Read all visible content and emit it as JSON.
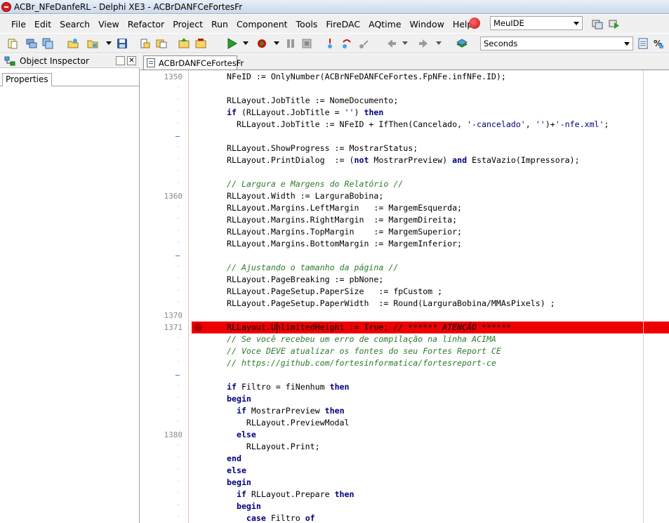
{
  "window": {
    "title": "ACBr_NFeDanfeRL - Delphi XE3 - ACBrDANFCeFortesFr",
    "app_icon": "delphi-icon"
  },
  "menu": {
    "items": [
      "File",
      "Edit",
      "Search",
      "View",
      "Refactor",
      "Project",
      "Run",
      "Component",
      "Tools",
      "FireDAC",
      "AQtime",
      "Window",
      "Help"
    ],
    "desktop_combo": "MeuIDE",
    "units_combo": "Seconds"
  },
  "object_inspector": {
    "title": "Object Inspector",
    "tab": "Properties"
  },
  "editor": {
    "tab_label": "ACBrDANFCeFortesFr",
    "line_numbers": [
      {
        "row": 0,
        "label": "1350"
      },
      {
        "row": 10,
        "label": "1360"
      },
      {
        "row": 20,
        "label": "1370"
      },
      {
        "row": 21,
        "label": "1371"
      },
      {
        "row": 30,
        "label": "1380"
      }
    ],
    "highlighted_row": 21,
    "lines": [
      "NFeID := OnlyNumber(ACBrNFeDANFCeFortes.FpNFe.infNFe.ID);",
      "",
      "RLLayout.JobTitle := NomeDocumento;",
      "if (RLLayout.JobTitle = '') then",
      "  RLLayout.JobTitle := NFeID + IfThen(Cancelado, '-cancelado', '')+'-nfe.xml';",
      "",
      "RLLayout.ShowProgress := MostrarStatus;",
      "RLLayout.PrintDialog  := (not MostrarPreview) and EstaVazio(Impressora);",
      "",
      "// Largura e Margens do Relatório //",
      "RLLayout.Width := LarguraBobina;",
      "RLLayout.Margins.LeftMargin   := MargemEsquerda;",
      "RLLayout.Margins.RightMargin  := MargemDireita;",
      "RLLayout.Margins.TopMargin    := MargemSuperior;",
      "RLLayout.Margins.BottomMargin := MargemInferior;",
      "",
      "// Ajustando o tamanho da página //",
      "RLLayout.PageBreaking := pbNone;",
      "RLLayout.PageSetup.PaperSize   := fpCustom ;",
      "RLLayout.PageSetup.PaperWidth  := Round(LarguraBobina/MMAsPixels) ;",
      "",
      "RLLayout.UnlimitedHeight := True; // ****** ATENÇÃO ******",
      "// Se você recebeu um erro de compilação na linha ACIMA",
      "// Voce DEVE atualizar os fontes do seu Fortes Report CE",
      "// https://github.com/fortesinformatica/fortesreport-ce",
      "",
      "if Filtro = fiNenhum then",
      "begin",
      "  if MostrarPreview then",
      "    RLLayout.PreviewModal",
      "  else",
      "    RLLayout.Print;",
      "end",
      "else",
      "begin",
      "  if RLLayout.Prepare then",
      "  begin",
      "    case Filtro of"
    ]
  }
}
